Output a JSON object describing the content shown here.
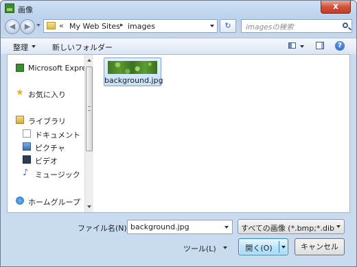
{
  "window": {
    "title": "画像",
    "close_label": "x"
  },
  "navigation": {
    "back_glyph": "◀",
    "forward_glyph": "▶",
    "breadcrumb_chevrons": "«",
    "breadcrumbs": [
      "My Web Sites",
      "images"
    ],
    "breadcrumb_separator": "▸",
    "refresh_glyph": "↻",
    "search_placeholder": "imagesの検索"
  },
  "toolbar": {
    "organize": "整理",
    "new_folder": "新しいフォルダー",
    "help": "?"
  },
  "nav_pane": {
    "items": [
      {
        "label": "Microsoft Expression Web",
        "icon": "application-icon"
      },
      {
        "label": "お気に入り",
        "icon": "favorites-star-icon"
      },
      {
        "label": "ライブラリ",
        "icon": "libraries-icon"
      },
      {
        "label": "ドキュメント",
        "icon": "documents-icon"
      },
      {
        "label": "ピクチャ",
        "icon": "pictures-icon"
      },
      {
        "label": "ビデオ",
        "icon": "videos-icon"
      },
      {
        "label": "ミュージック",
        "icon": "music-icon"
      },
      {
        "label": "ホームグループ",
        "icon": "homegroup-icon"
      }
    ]
  },
  "files": [
    {
      "name": "background.jpg",
      "selected": true
    }
  ],
  "footer": {
    "filename_label": "ファイル名(N):",
    "filename_value": "background.jpg",
    "filetype_value": "すべての画像 (*.bmp;*.dib;*",
    "tools_label": "ツール(L)",
    "open_label": "開く(O)",
    "cancel_label": "キャンセル"
  }
}
